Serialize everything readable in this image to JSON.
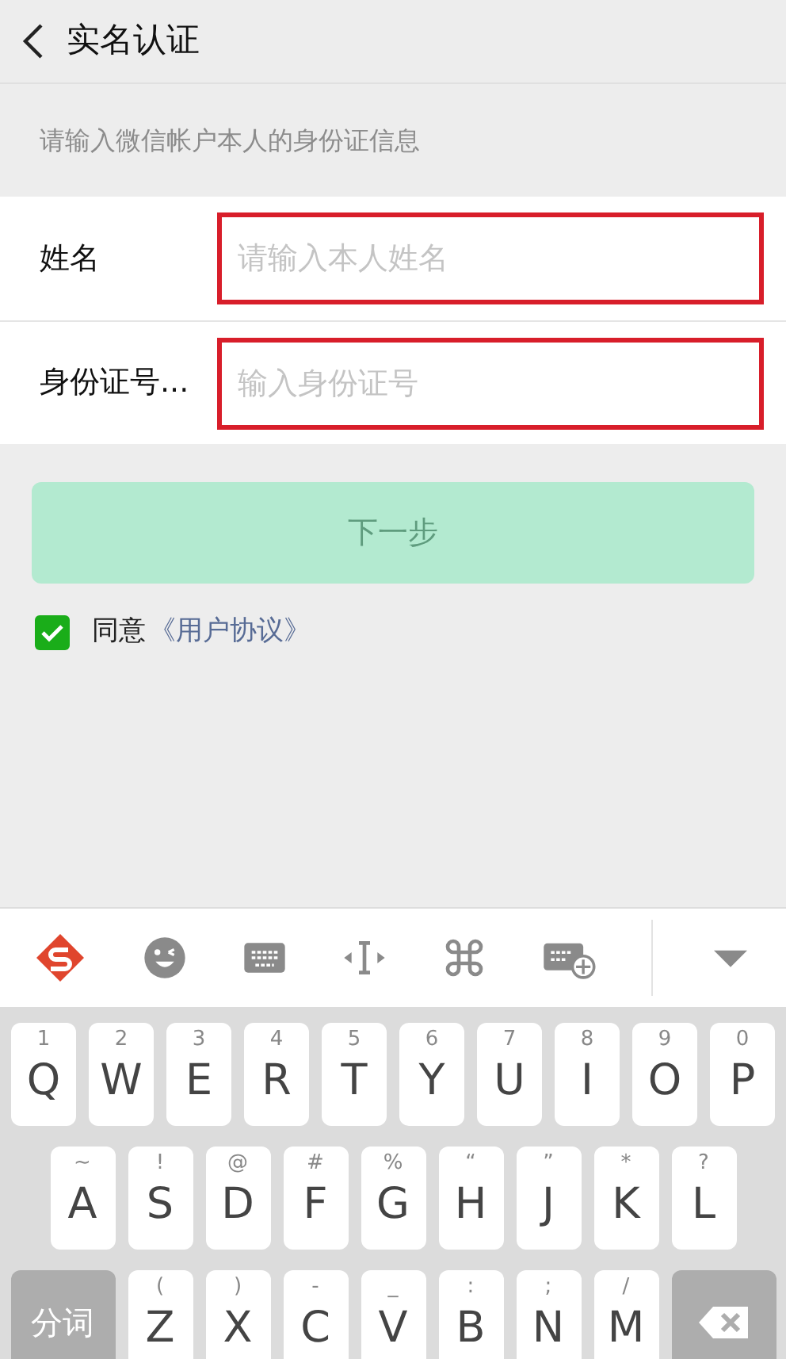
{
  "header": {
    "title": "实名认证"
  },
  "hint": "请输入微信帐户本人的身份证信息",
  "fields": [
    {
      "label": "姓名",
      "placeholder": "请输入本人姓名",
      "highlighted": true
    },
    {
      "label": "身份证号...",
      "placeholder": "输入身份证号",
      "highlighted": true
    }
  ],
  "next_button": {
    "label": "下一步",
    "disabled": true
  },
  "agreement": {
    "checked": true,
    "text": "同意",
    "link": "《用户协议》"
  },
  "keyboard": {
    "rows": [
      [
        {
          "label": "Q",
          "sub": "1"
        },
        {
          "label": "W",
          "sub": "2"
        },
        {
          "label": "E",
          "sub": "3"
        },
        {
          "label": "R",
          "sub": "4"
        },
        {
          "label": "T",
          "sub": "5"
        },
        {
          "label": "Y",
          "sub": "6"
        },
        {
          "label": "U",
          "sub": "7"
        },
        {
          "label": "I",
          "sub": "8"
        },
        {
          "label": "O",
          "sub": "9"
        },
        {
          "label": "P",
          "sub": "0"
        }
      ],
      [
        {
          "label": "A",
          "sub": "~"
        },
        {
          "label": "S",
          "sub": "!"
        },
        {
          "label": "D",
          "sub": "@"
        },
        {
          "label": "F",
          "sub": "#"
        },
        {
          "label": "G",
          "sub": "%"
        },
        {
          "label": "H",
          "sub": "“"
        },
        {
          "label": "J",
          "sub": "”"
        },
        {
          "label": "K",
          "sub": "*"
        },
        {
          "label": "L",
          "sub": "?"
        }
      ],
      [
        {
          "kind": "function",
          "label": "分词"
        },
        {
          "label": "Z",
          "sub": "("
        },
        {
          "label": "X",
          "sub": ")"
        },
        {
          "label": "C",
          "sub": "-"
        },
        {
          "label": "V",
          "sub": "_"
        },
        {
          "label": "B",
          "sub": ":"
        },
        {
          "label": "N",
          "sub": ";"
        },
        {
          "label": "M",
          "sub": "/"
        },
        {
          "kind": "backspace"
        }
      ]
    ]
  }
}
